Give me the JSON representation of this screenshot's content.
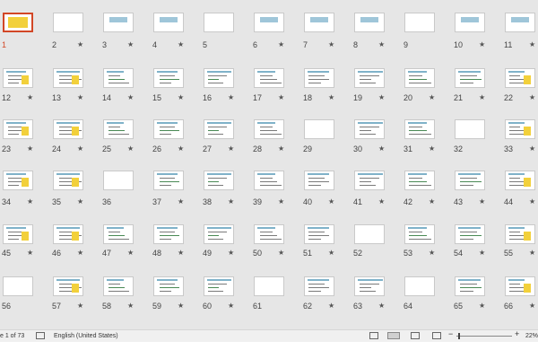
{
  "slides": [
    {
      "num": "1",
      "star": ""
    },
    {
      "num": "2",
      "star": "★"
    },
    {
      "num": "3",
      "star": "★"
    },
    {
      "num": "4",
      "star": "★"
    },
    {
      "num": "5",
      "star": ""
    },
    {
      "num": "6",
      "star": "★"
    },
    {
      "num": "7",
      "star": "★"
    },
    {
      "num": "8",
      "star": "★"
    },
    {
      "num": "9",
      "star": ""
    },
    {
      "num": "10",
      "star": "★"
    },
    {
      "num": "11",
      "star": "★"
    },
    {
      "num": "12",
      "star": "★"
    },
    {
      "num": "13",
      "star": "★"
    },
    {
      "num": "14",
      "star": "★"
    },
    {
      "num": "15",
      "star": "★"
    },
    {
      "num": "16",
      "star": "★"
    },
    {
      "num": "17",
      "star": "★"
    },
    {
      "num": "18",
      "star": "★"
    },
    {
      "num": "19",
      "star": "★"
    },
    {
      "num": "20",
      "star": "★"
    },
    {
      "num": "21",
      "star": "★"
    },
    {
      "num": "22",
      "star": "★"
    },
    {
      "num": "23",
      "star": "★"
    },
    {
      "num": "24",
      "star": "★"
    },
    {
      "num": "25",
      "star": "★"
    },
    {
      "num": "26",
      "star": "★"
    },
    {
      "num": "27",
      "star": "★"
    },
    {
      "num": "28",
      "star": "★"
    },
    {
      "num": "29",
      "star": ""
    },
    {
      "num": "30",
      "star": "★"
    },
    {
      "num": "31",
      "star": "★"
    },
    {
      "num": "32",
      "star": ""
    },
    {
      "num": "33",
      "star": "★"
    },
    {
      "num": "34",
      "star": "★"
    },
    {
      "num": "35",
      "star": "★"
    },
    {
      "num": "36",
      "star": ""
    },
    {
      "num": "37",
      "star": "★"
    },
    {
      "num": "38",
      "star": "★"
    },
    {
      "num": "39",
      "star": "★"
    },
    {
      "num": "40",
      "star": "★"
    },
    {
      "num": "41",
      "star": "★"
    },
    {
      "num": "42",
      "star": "★"
    },
    {
      "num": "43",
      "star": "★"
    },
    {
      "num": "44",
      "star": "★"
    },
    {
      "num": "45",
      "star": "★"
    },
    {
      "num": "46",
      "star": "★"
    },
    {
      "num": "47",
      "star": "★"
    },
    {
      "num": "48",
      "star": "★"
    },
    {
      "num": "49",
      "star": "★"
    },
    {
      "num": "50",
      "star": "★"
    },
    {
      "num": "51",
      "star": "★"
    },
    {
      "num": "52",
      "star": ""
    },
    {
      "num": "53",
      "star": "★"
    },
    {
      "num": "54",
      "star": "★"
    },
    {
      "num": "55",
      "star": "★"
    },
    {
      "num": "56",
      "star": ""
    },
    {
      "num": "57",
      "star": "★"
    },
    {
      "num": "58",
      "star": "★"
    },
    {
      "num": "59",
      "star": "★"
    },
    {
      "num": "60",
      "star": "★"
    },
    {
      "num": "61",
      "star": ""
    },
    {
      "num": "62",
      "star": "★"
    },
    {
      "num": "63",
      "star": "★"
    },
    {
      "num": "64",
      "star": ""
    },
    {
      "num": "65",
      "star": "★"
    },
    {
      "num": "66",
      "star": "★"
    }
  ],
  "selected_slide": "1",
  "status": {
    "slide_counter": "e 1 of 73",
    "language": "English (United States)",
    "zoom_minus": "−",
    "zoom_plus": "+",
    "zoom": "22%",
    "zoom_level_fraction": 0.22
  },
  "colors": {
    "accent": "#d24726"
  }
}
